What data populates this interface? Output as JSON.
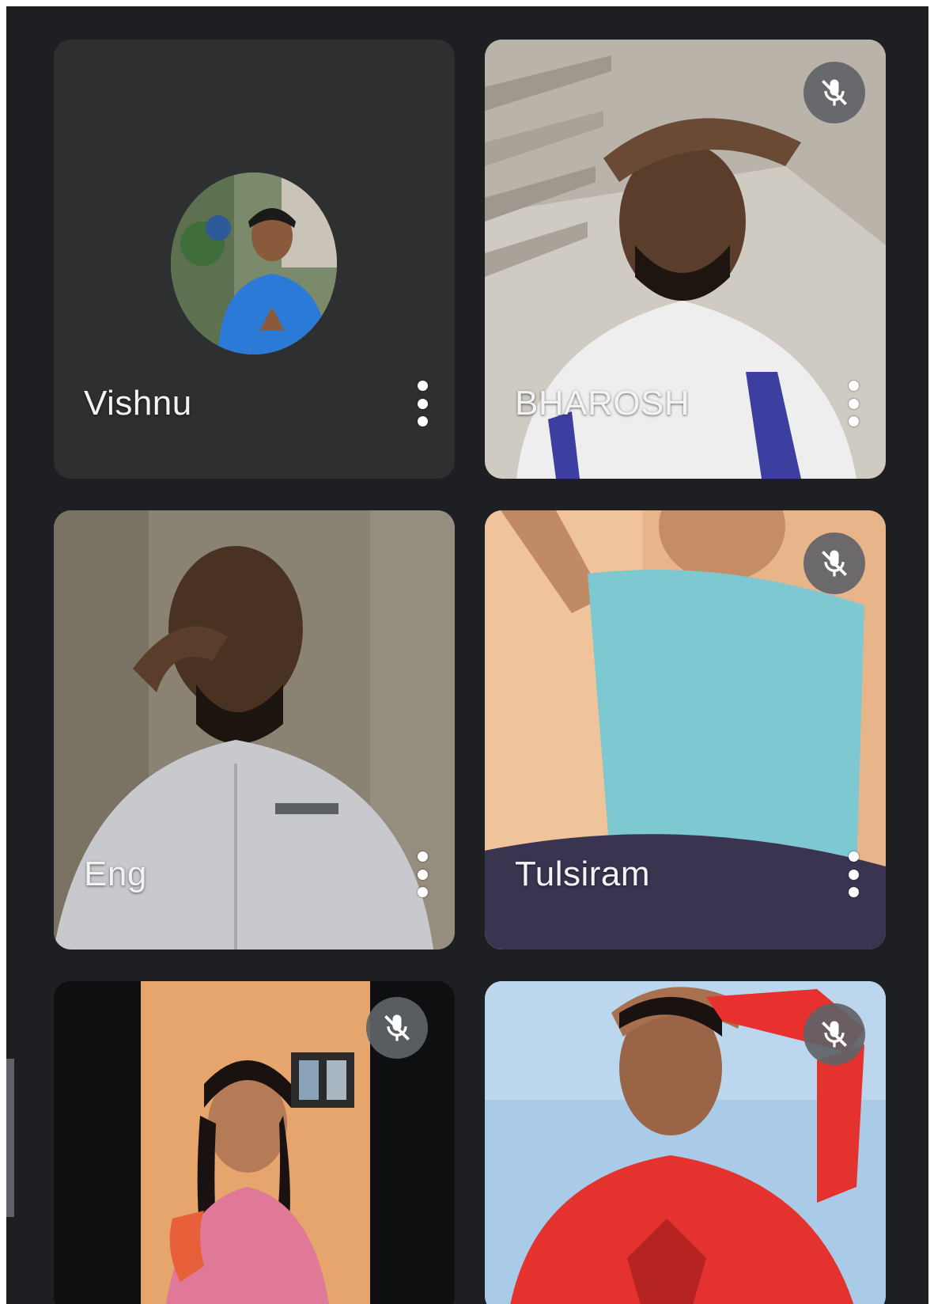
{
  "colors": {
    "background": "#1e1f22",
    "tile": "#2d2f31",
    "mute_badge": "#5f6368",
    "text": "#f1f3f4"
  },
  "participants": [
    {
      "name": "Vishnu",
      "muted": false,
      "video": false,
      "icon": "profile-photo-avatar"
    },
    {
      "name": "BHAROSH",
      "muted": true,
      "video": true,
      "icon": "mic-off-icon"
    },
    {
      "name": "Eng",
      "muted": false,
      "video": true,
      "icon": ""
    },
    {
      "name": "Tulsiram",
      "muted": true,
      "video": true,
      "icon": "mic-off-icon"
    },
    {
      "name": "",
      "muted": true,
      "video": true,
      "icon": "mic-off-icon"
    },
    {
      "name": "",
      "muted": true,
      "video": true,
      "icon": "mic-off-icon"
    }
  ],
  "icons": {
    "more_options": "more-vert-icon",
    "muted": "mic-off-icon"
  }
}
